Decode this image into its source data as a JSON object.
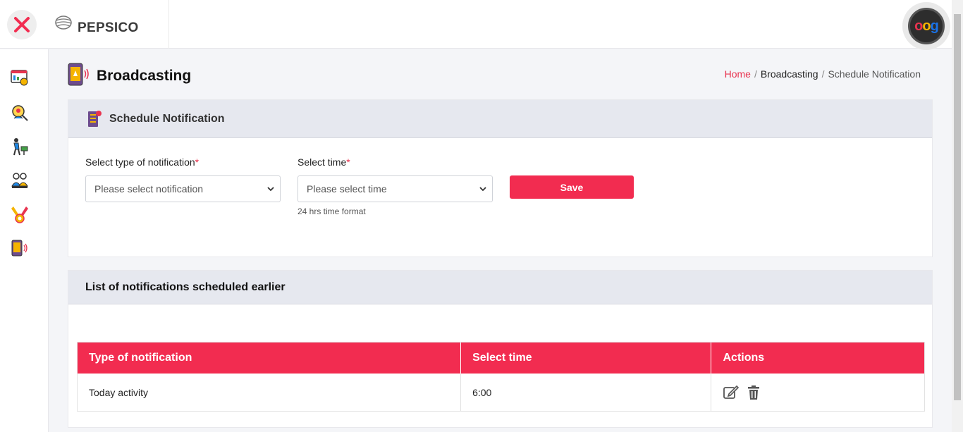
{
  "header": {
    "logo_text": "PEPSICO",
    "avatar_text": "oog"
  },
  "page": {
    "title": "Broadcasting",
    "breadcrumb": {
      "home": "Home",
      "section": "Broadcasting",
      "current": "Schedule Notification",
      "separator": "/"
    }
  },
  "schedule_form": {
    "title": "Schedule Notification",
    "type_label": "Select type of notification",
    "type_placeholder": "Please select notification",
    "time_label": "Select time",
    "time_placeholder": "Please select time",
    "required_mark": "*",
    "time_hint": "24 hrs time format",
    "save_label": "Save"
  },
  "list": {
    "title": "List of notifications scheduled earlier",
    "columns": [
      "Type of notification",
      "Select time",
      "Actions"
    ],
    "rows": [
      {
        "type": "Today activity",
        "time": "6:00"
      }
    ]
  },
  "colors": {
    "accent": "#f22c50",
    "link": "#e8334f",
    "header_bg": "#e6e8ef"
  },
  "icons": {
    "close": "close-icon",
    "edit": "edit-icon",
    "delete": "trash-icon"
  }
}
